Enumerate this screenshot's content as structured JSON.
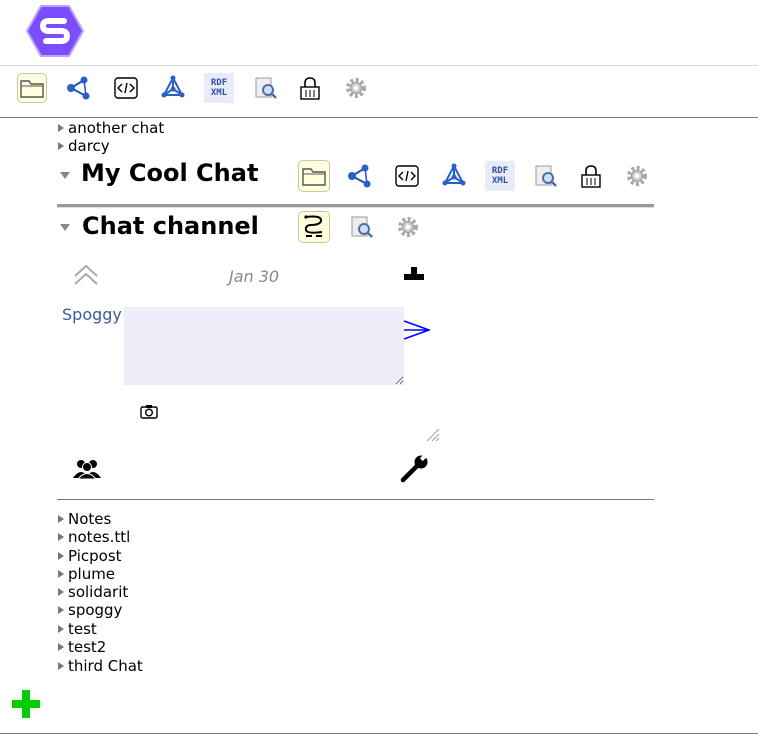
{
  "app": {
    "logo_letter": "S"
  },
  "toolbar": {
    "icons": [
      "folder-icon",
      "network-icon",
      "code-icon",
      "graph-icon",
      "rdf-xml-icon",
      "search-doc-icon",
      "lock-icon",
      "gear-icon"
    ],
    "rdf_text_1": "RDF",
    "rdf_text_2": "XML"
  },
  "tree": {
    "top_items": [
      "another chat",
      "darcy"
    ],
    "bottom_items": [
      "Notes",
      "notes.ttl",
      "Picpost",
      "plume",
      "solidarit",
      "spoggy",
      "test",
      "test2",
      "third Chat"
    ]
  },
  "folder_pane": {
    "title": "My Cool Chat"
  },
  "chat_pane": {
    "title": "Chat channel",
    "date_label": "Jan 30",
    "author": "Spoggy",
    "message_input_value": ""
  },
  "colors": {
    "logo": "#7c4dff",
    "input_bg": "#eeeefa",
    "add": "#00cc00",
    "send": "#0000ff",
    "author": "#3b5998"
  }
}
